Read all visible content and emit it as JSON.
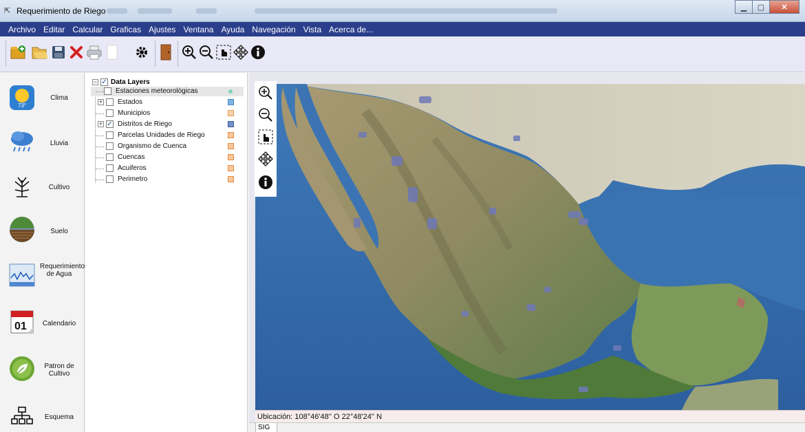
{
  "window": {
    "title": "Requerimiento de Riego"
  },
  "menu": [
    "Archivo",
    "Editar",
    "Calcular",
    "Graficas",
    "Ajustes",
    "Ventana",
    "Ayuda",
    "Navegación",
    "Vista",
    "Acerca de..."
  ],
  "toolbar": {
    "icons": [
      "add-folder-icon",
      "open-folder-icon",
      "save-icon",
      "delete-icon",
      "print-icon",
      "blank-page-icon",
      "settings-gear-icon",
      "door-exit-icon",
      "zoom-in-icon",
      "zoom-out-icon",
      "select-hand-icon",
      "pan-arrows-icon",
      "info-icon"
    ]
  },
  "sidebar": {
    "items": [
      {
        "label": "Clima",
        "icon": "weather-sun-icon"
      },
      {
        "label": "Lluvia",
        "icon": "rain-cloud-icon"
      },
      {
        "label": "Cultivo",
        "icon": "plant-icon"
      },
      {
        "label": "Suelo",
        "icon": "soil-field-icon"
      },
      {
        "label": "Requerimientos de Agua",
        "icon": "water-chart-icon"
      },
      {
        "label": "Calendario",
        "icon": "calendar-icon"
      },
      {
        "label": "Patron de Cultivo",
        "icon": "leaf-badge-icon"
      },
      {
        "label": "Esquema",
        "icon": "hierarchy-icon"
      }
    ]
  },
  "layers": {
    "root_label": "Data Layers",
    "root_checked": true,
    "items": [
      {
        "label": "Estaciones meteorológicas",
        "checked": false,
        "expandable": false,
        "swatch": "#7fd3b5",
        "dot": true,
        "selected": true
      },
      {
        "label": "Estados",
        "checked": false,
        "expandable": true,
        "swatch": "#7db6e6"
      },
      {
        "label": "Municipios",
        "checked": false,
        "expandable": false,
        "swatch": "#f3c08c"
      },
      {
        "label": "Distritos de Riego",
        "checked": true,
        "expandable": true,
        "swatch": "#7090c8"
      },
      {
        "label": "Parcelas Unidades de Riego",
        "checked": false,
        "expandable": false,
        "swatch": "#f3b27a"
      },
      {
        "label": "Organismo de Cuenca",
        "checked": false,
        "expandable": false,
        "swatch": "#f3b27a"
      },
      {
        "label": "Cuencas",
        "checked": false,
        "expandable": false,
        "swatch": "#f3b27a"
      },
      {
        "label": "Acuiferos",
        "checked": false,
        "expandable": false,
        "swatch": "#f3b27a"
      },
      {
        "label": "Perimetro",
        "checked": false,
        "expandable": false,
        "swatch": "#f3b27a"
      }
    ]
  },
  "map": {
    "tools": [
      "zoom-in-icon",
      "zoom-out-icon",
      "select-hand-icon",
      "pan-arrows-icon",
      "info-icon"
    ],
    "status_text": "Ubicación: 108°46'48'' O  22°48'24'' N",
    "tab_label": "SIG"
  }
}
